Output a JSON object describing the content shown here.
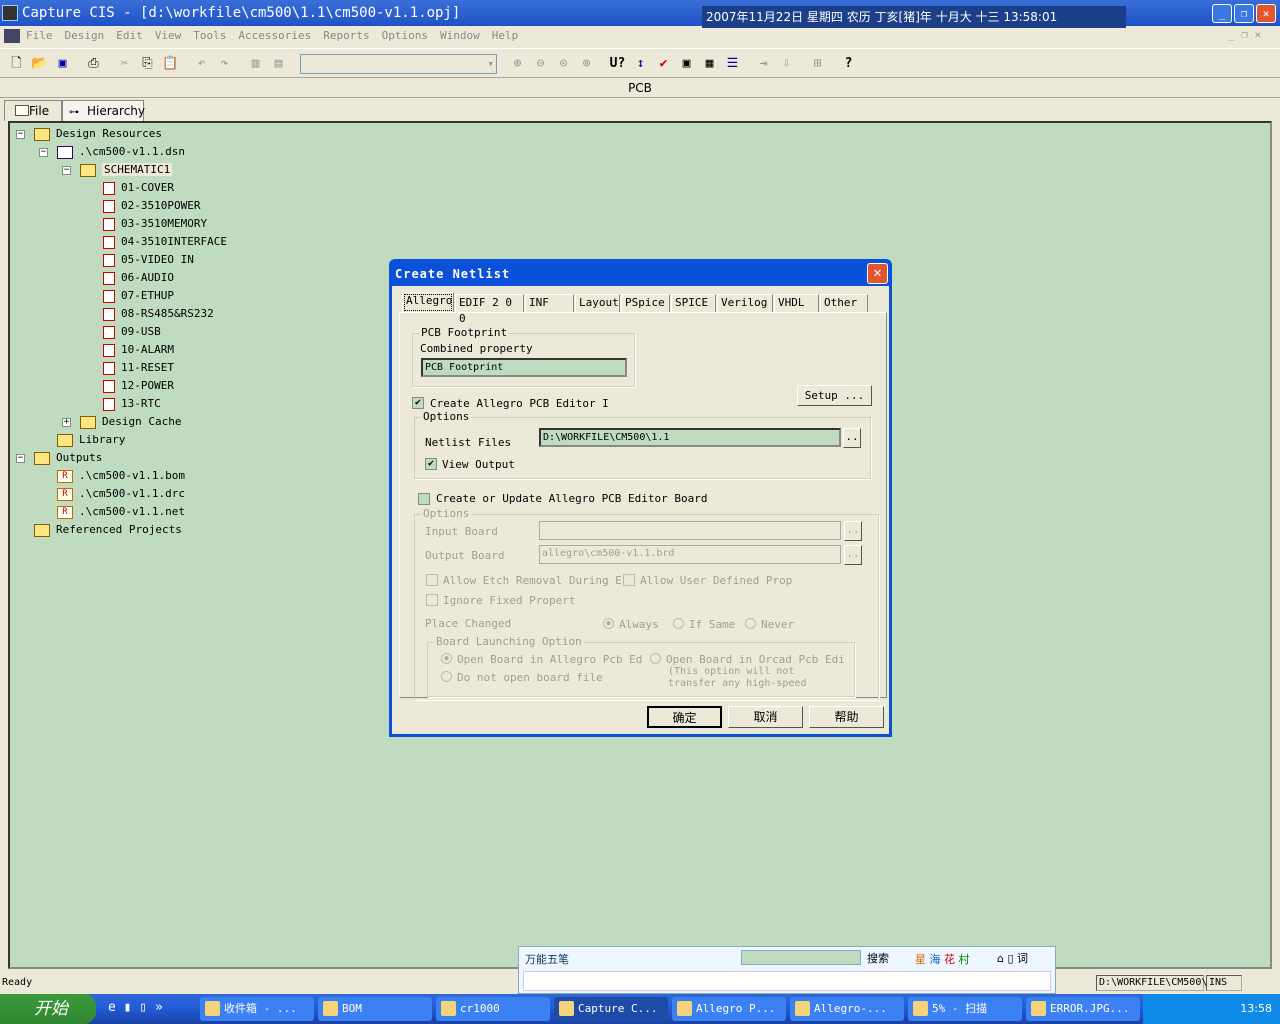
{
  "window": {
    "title": "Capture CIS - [d:\\workfile\\cm500\\1.1\\cm500-v1.1.opj]",
    "clock": "2007年11月22日 星期四 农历 丁亥[猪]年 十月大 十三  13:58:01"
  },
  "menu": [
    "File",
    "Design",
    "Edit",
    "View",
    "Tools",
    "Accessories",
    "Reports",
    "Options",
    "Window",
    "Help"
  ],
  "header": {
    "title": "PCB"
  },
  "panel_tabs": [
    {
      "label": "File"
    },
    {
      "label": "Hierarchy"
    }
  ],
  "tree": [
    {
      "label": "Design Resources",
      "level": 0,
      "icon": "folder",
      "expander": "-"
    },
    {
      "label": ".\\cm500-v1.1.dsn",
      "level": 1,
      "icon": "dsn",
      "expander": "-"
    },
    {
      "label": "SCHEMATIC1",
      "level": 2,
      "icon": "folder",
      "expander": "-"
    },
    {
      "label": "01-COVER",
      "level": 3,
      "icon": "page"
    },
    {
      "label": "02-3510POWER",
      "level": 3,
      "icon": "page"
    },
    {
      "label": "03-3510MEMORY",
      "level": 3,
      "icon": "page"
    },
    {
      "label": "04-3510INTERFACE",
      "level": 3,
      "icon": "page"
    },
    {
      "label": "05-VIDEO IN",
      "level": 3,
      "icon": "page"
    },
    {
      "label": "06-AUDIO",
      "level": 3,
      "icon": "page"
    },
    {
      "label": "07-ETHUP",
      "level": 3,
      "icon": "page"
    },
    {
      "label": "08-RS485&RS232",
      "level": 3,
      "icon": "page"
    },
    {
      "label": "09-USB",
      "level": 3,
      "icon": "page"
    },
    {
      "label": "10-ALARM",
      "level": 3,
      "icon": "page"
    },
    {
      "label": "11-RESET",
      "level": 3,
      "icon": "page"
    },
    {
      "label": "12-POWER",
      "level": 3,
      "icon": "page"
    },
    {
      "label": "13-RTC",
      "level": 3,
      "icon": "page"
    },
    {
      "label": "Design Cache",
      "level": 2,
      "icon": "folder",
      "expander": "+"
    },
    {
      "label": "Library",
      "level": 1,
      "icon": "folder"
    },
    {
      "label": "Outputs",
      "level": 0,
      "icon": "folder",
      "expander": "-"
    },
    {
      "label": ".\\cm500-v1.1.bom",
      "level": 1,
      "icon": "rep"
    },
    {
      "label": ".\\cm500-v1.1.drc",
      "level": 1,
      "icon": "rep"
    },
    {
      "label": ".\\cm500-v1.1.net",
      "level": 1,
      "icon": "rep"
    },
    {
      "label": "Referenced Projects",
      "level": 0,
      "icon": "folder"
    }
  ],
  "dialog": {
    "title": "Create Netlist",
    "tabs": [
      "Allegro",
      "EDIF 2 0 0",
      "INF",
      "Layout",
      "PSpice",
      "SPICE",
      "Verilog",
      "VHDL",
      "Other"
    ],
    "pcb_footprint_group": "PCB Footprint",
    "combined_property_label": "Combined property",
    "combined_property_value": "PCB Footprint",
    "create_allegro_label": "Create Allegro PCB Editor I",
    "create_allegro_checked": true,
    "setup_label": "Setup ...",
    "options_label": "Options",
    "netlist_files_label": "Netlist Files",
    "netlist_files_value": "D:\\WORKFILE\\CM500\\1.1",
    "browse_label": "..",
    "view_output_label": "View Output",
    "view_output_checked": true,
    "update_board_label": "Create or Update Allegro PCB Editor Board",
    "update_board_checked": false,
    "options2_label": "Options",
    "input_board_label": "Input Board",
    "input_board_value": "",
    "output_board_label": "Output Board",
    "output_board_value": "allegro\\cm500-v1.1.brd",
    "allow_etch_label": "Allow Etch Removal During E",
    "allow_user_label": "Allow User Defined Prop",
    "ignore_fixed_label": "Ignore Fixed Propert",
    "place_changed_label": "Place Changed",
    "place_options": [
      "Always",
      "If Same",
      "Never"
    ],
    "place_selected": "Always",
    "launch_group": "Board Launching Option",
    "launch_allegro": "Open Board in Allegro Pcb Ed",
    "launch_none": "Do not open board file",
    "launch_orcad": "Open Board in Orcad Pcb Edi",
    "launch_note1": "(This option will not",
    "launch_note2": "transfer any high-speed",
    "ok": "确定",
    "cancel": "取消",
    "help": "帮助"
  },
  "status": {
    "text": "Ready",
    "path": "D:\\WORKFILE\\CM500\\",
    "mode": "INS"
  },
  "ime": {
    "name": "万能五笔",
    "search": "搜索",
    "brand": [
      "星",
      "海",
      "花",
      "村"
    ],
    "icons": [
      "⌂",
      "▯",
      "词"
    ]
  },
  "taskbar": {
    "start": "开始",
    "tasks": [
      "收件箱 - ...",
      "BOM",
      "cr1000",
      "Capture C...",
      "Allegro P...",
      "Allegro-...",
      "5% - 扫描",
      "ERROR.JPG..."
    ],
    "active": 3,
    "time": "13:58"
  }
}
